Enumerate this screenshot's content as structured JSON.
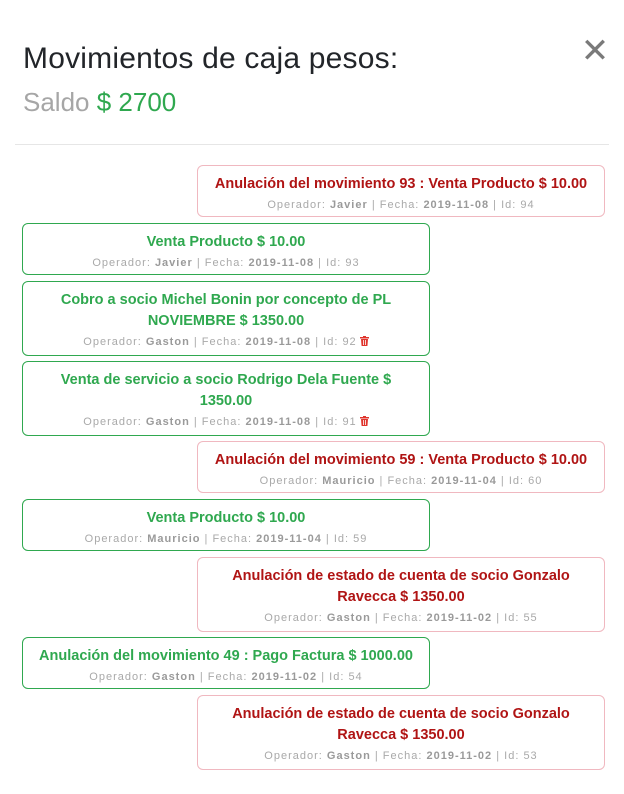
{
  "header": {
    "title": "Movimientos de caja pesos:",
    "saldo_label": "Saldo",
    "saldo_value": "$ 2700",
    "close_symbol": "✕"
  },
  "labels": {
    "operador": "Operador:",
    "fecha": "Fecha:",
    "id": "Id:",
    "sep": "|"
  },
  "colors": {
    "ingreso": "#2fa84f",
    "anulacion": "#b01414",
    "anulacion_border": "#f0b8c0"
  },
  "movements": [
    {
      "side": "right",
      "desc": "Anulación del movimiento 93 : Venta Producto $ 10.00",
      "operador": "Javier",
      "fecha": "2019-11-08",
      "id": "94",
      "trash": false
    },
    {
      "side": "left",
      "desc": "Venta Producto $ 10.00",
      "operador": "Javier",
      "fecha": "2019-11-08",
      "id": "93",
      "trash": false
    },
    {
      "side": "left",
      "desc": "Cobro a socio Michel Bonin por concepto de PL NOVIEMBRE $ 1350.00",
      "operador": "Gaston",
      "fecha": "2019-11-08",
      "id": "92",
      "trash": true
    },
    {
      "side": "left",
      "desc": "Venta de servicio a socio Rodrigo Dela Fuente $ 1350.00",
      "operador": "Gaston",
      "fecha": "2019-11-08",
      "id": "91",
      "trash": true
    },
    {
      "side": "right",
      "desc": "Anulación del movimiento 59 : Venta Producto $ 10.00",
      "operador": "Mauricio",
      "fecha": "2019-11-04",
      "id": "60",
      "trash": false
    },
    {
      "side": "left",
      "desc": "Venta Producto $ 10.00",
      "operador": "Mauricio",
      "fecha": "2019-11-04",
      "id": "59",
      "trash": false
    },
    {
      "side": "right",
      "desc": "Anulación de estado de cuenta de socio Gonzalo Ravecca $ 1350.00",
      "operador": "Gaston",
      "fecha": "2019-11-02",
      "id": "55",
      "trash": false
    },
    {
      "side": "left",
      "desc": "Anulación del movimiento 49 : Pago Factura $ 1000.00",
      "operador": "Gaston",
      "fecha": "2019-11-02",
      "id": "54",
      "trash": false
    },
    {
      "side": "right",
      "desc": "Anulación de estado de cuenta de socio Gonzalo Ravecca $ 1350.00",
      "operador": "Gaston",
      "fecha": "2019-11-02",
      "id": "53",
      "trash": false
    }
  ]
}
